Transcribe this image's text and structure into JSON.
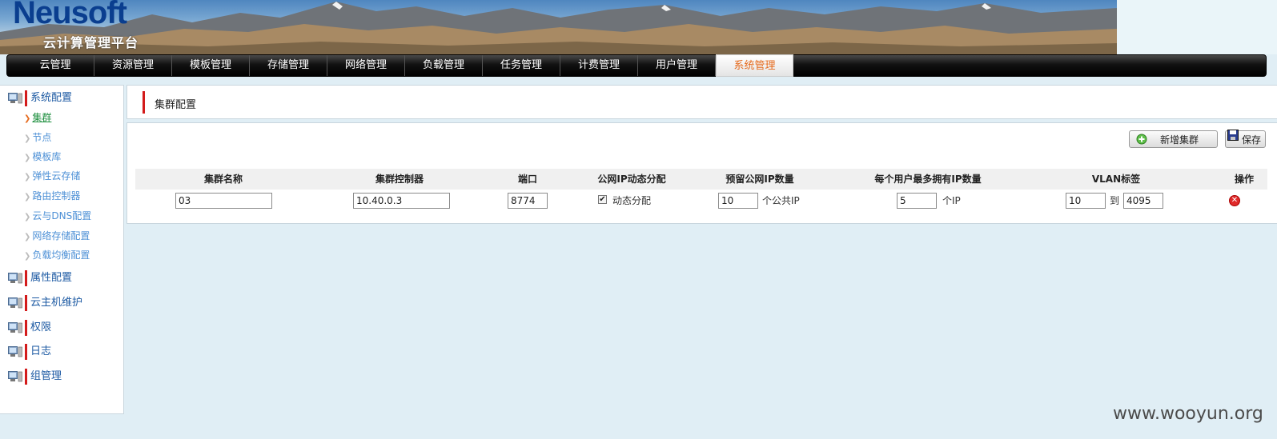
{
  "header": {
    "logo": "Neusoft",
    "subtitle": "云计算管理平台"
  },
  "nav": {
    "tabs": [
      {
        "label": "云管理"
      },
      {
        "label": "资源管理"
      },
      {
        "label": "模板管理"
      },
      {
        "label": "存储管理"
      },
      {
        "label": "网络管理"
      },
      {
        "label": "负载管理"
      },
      {
        "label": "任务管理"
      },
      {
        "label": "计费管理"
      },
      {
        "label": "用户管理"
      },
      {
        "label": "系统管理"
      }
    ],
    "active": "系统管理"
  },
  "sidebar": {
    "sections": [
      {
        "label": "系统配置"
      },
      {
        "label": "属性配置"
      },
      {
        "label": "云主机维护"
      },
      {
        "label": "权限"
      },
      {
        "label": "日志"
      },
      {
        "label": "组管理"
      }
    ],
    "subitems": [
      {
        "label": "集群"
      },
      {
        "label": "节点"
      },
      {
        "label": "模板库"
      },
      {
        "label": "弹性云存储"
      },
      {
        "label": "路由控制器"
      },
      {
        "label": "云与DNS配置"
      },
      {
        "label": "网络存储配置"
      },
      {
        "label": "负载均衡配置"
      }
    ],
    "active_subitem": "集群"
  },
  "page": {
    "title": "集群配置"
  },
  "toolbar": {
    "add_label": "新增集群",
    "save_label": "保存"
  },
  "table": {
    "headers": [
      "集群名称",
      "集群控制器",
      "端口",
      "公网IP动态分配",
      "预留公网IP数量",
      "每个用户最多拥有IP数量",
      "VLAN标签",
      "操作"
    ],
    "row": {
      "name": "03",
      "controller": "10.40.0.3",
      "port": "8774",
      "dynamic_checked": true,
      "dynamic_label": "动态分配",
      "reserved_ip": "10",
      "reserved_unit": "个公共IP",
      "max_ip": "5",
      "max_unit": "个IP",
      "vlan_from": "10",
      "vlan_to_label": "到",
      "vlan_to": "4095"
    }
  },
  "watermark": "www.wooyun.org",
  "colors": {
    "accent_red": "#d31b1b",
    "active_tab_text": "#e56a1d",
    "sidebar_link": "#4d90d6",
    "sidebar_section": "#1d5aa3",
    "active_link": "#1e8f3f"
  }
}
